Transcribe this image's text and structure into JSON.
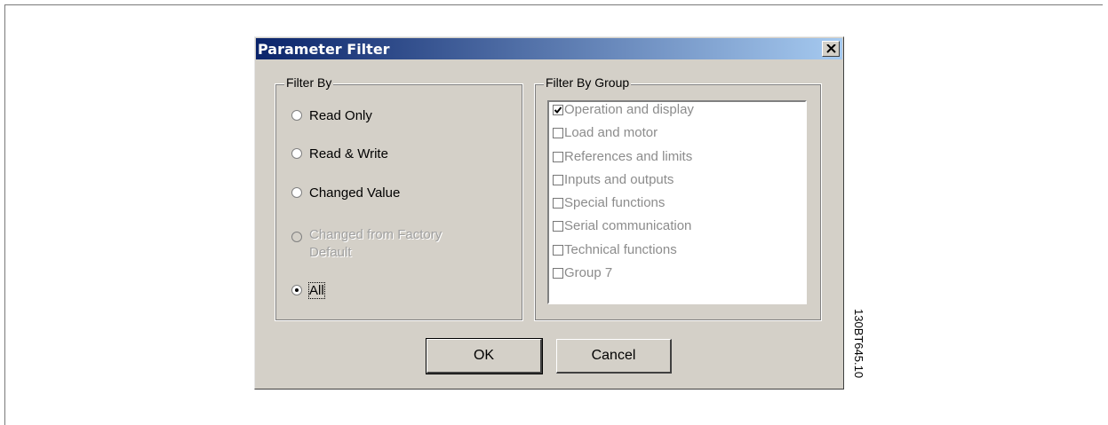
{
  "dialog": {
    "title": "Parameter Filter",
    "close_label": "×"
  },
  "filter_by": {
    "legend": "Filter By",
    "options": [
      {
        "label": "Read Only",
        "checked": false,
        "enabled": true
      },
      {
        "label": "Read & Write",
        "checked": false,
        "enabled": true
      },
      {
        "label": "Changed Value",
        "checked": false,
        "enabled": true
      },
      {
        "label": "Changed from Factory Default",
        "checked": false,
        "enabled": false
      },
      {
        "label": "All",
        "checked": true,
        "enabled": true
      }
    ]
  },
  "filter_by_group": {
    "legend": "Filter By Group",
    "items": [
      {
        "label": "Operation and display",
        "checked": true
      },
      {
        "label": "Load and motor",
        "checked": false
      },
      {
        "label": "References and limits",
        "checked": false
      },
      {
        "label": "Inputs and outputs",
        "checked": false
      },
      {
        "label": "Special functions",
        "checked": false
      },
      {
        "label": "Serial communication",
        "checked": false
      },
      {
        "label": "Technical functions",
        "checked": false
      },
      {
        "label": "Group 7",
        "checked": false
      }
    ]
  },
  "buttons": {
    "ok_label": "OK",
    "cancel_label": "Cancel"
  },
  "figure_code": "130BT645.10"
}
